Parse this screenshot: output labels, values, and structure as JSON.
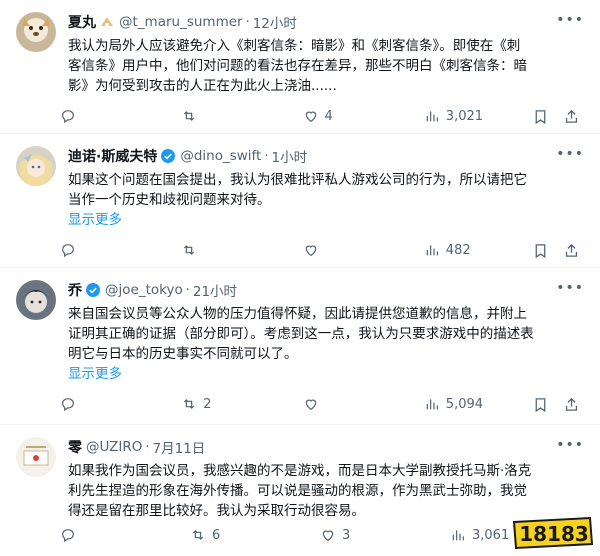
{
  "tweets": [
    {
      "name": "夏丸",
      "handle": "@t_maru_summer",
      "time": "12小时",
      "lines": [
        "我认为局外人应该避免介入《刺客信条：暗影》和《刺客信条》。即使在《刺",
        "客信条》用户中，他们对问题的看法也存在差异，那些不明白《刺客信条：暗",
        "影》为何受到攻击的人正在为此火上浇油......"
      ],
      "show_more": "",
      "replies": "",
      "retweets": "",
      "likes": "4",
      "views": "3,021"
    },
    {
      "name": "迪诺·斯威夫特",
      "handle": "@dino_swift",
      "time": "1小时",
      "lines": [
        "如果这个问题在国会提出，我认为很难批评私人游戏公司的行为，所以请把它",
        "当作一个历史和歧视问题来对待。"
      ],
      "show_more": "显示更多",
      "replies": "",
      "retweets": "",
      "likes": "",
      "views": "482"
    },
    {
      "name": "乔",
      "handle": "@joe_tokyo",
      "time": "21小时",
      "lines": [
        "来自国会议员等公众人物的压力值得怀疑，因此请提供您道歉的信息，并附上",
        "证明其正确的证据（部分即可）。考虑到这一点，我认为只要求游戏中的描述表",
        "明它与日本的历史事实不同就可以了。"
      ],
      "show_more": "显示更多",
      "replies": "",
      "retweets": "2",
      "likes": "",
      "views": "5,094"
    },
    {
      "name": "零",
      "handle": "@UZIRO",
      "time": "7月11日",
      "lines": [
        "如果我作为国会议员，我感兴趣的不是游戏，而是日本大学副教授托马斯·洛克",
        "利先生捏造的形象在海外传播。可以说是骚动的根源，作为黑武士弥助，我觉",
        "得还是留在那里比较好。我认为采取行动很容易。"
      ],
      "show_more": "",
      "replies": "",
      "retweets": "6",
      "likes": "3",
      "views": "3,061"
    }
  ],
  "colors": {
    "text": "#0f1419",
    "secondary": "#536471",
    "link": "#1d9bf0",
    "verified": "#1d9bf0",
    "border": "#eff3f4"
  },
  "icons": [
    "reply-icon",
    "retweet-icon",
    "like-icon",
    "views-icon",
    "bookmark-icon",
    "share-icon",
    "verified-badge-icon",
    "more-icon"
  ],
  "watermark": {
    "text": "18183"
  }
}
